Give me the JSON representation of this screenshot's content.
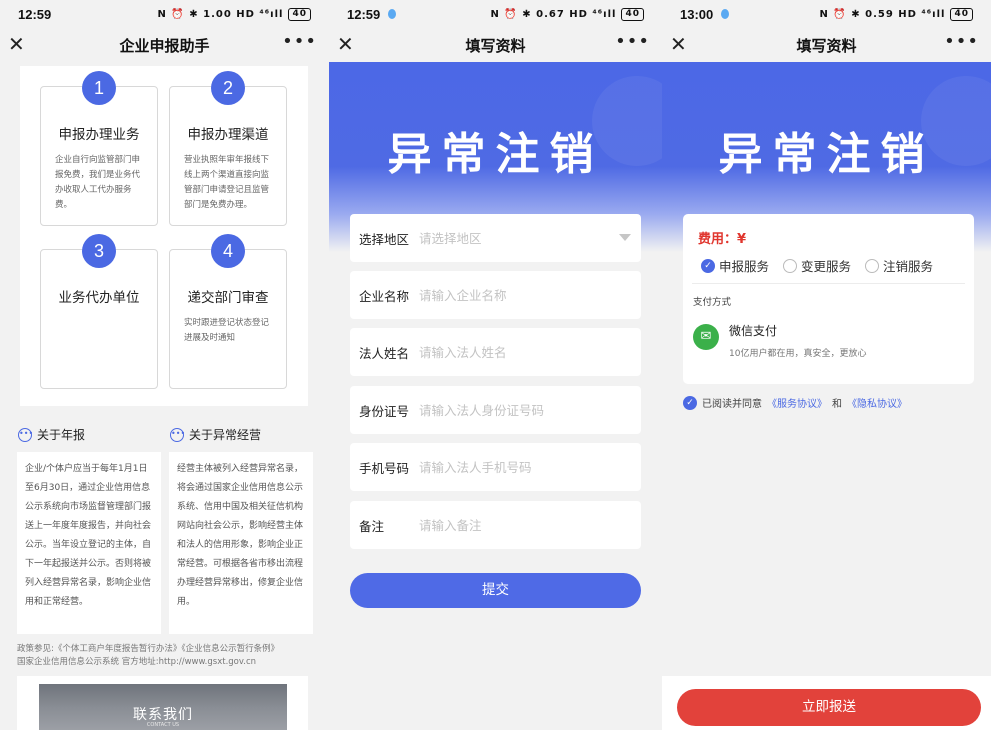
{
  "status_bars": [
    {
      "time": "12:59",
      "icons": "N ⏰ ✱ 1.00 HD ⁴⁶ıll",
      "battery": "40"
    },
    {
      "time": "12:59",
      "icons": "N ⏰ ✱ 0.67 HD ⁴⁶ıll",
      "battery": "40"
    },
    {
      "time": "13:00",
      "icons": "N ⏰ ✱ 0.59 HD ⁴⁶ıll",
      "battery": "40"
    }
  ],
  "nav": {
    "close": "✕",
    "more": "•••",
    "titles": [
      "企业申报助手",
      "填写资料",
      "填写资料"
    ]
  },
  "steps": [
    {
      "num": "1",
      "title": "申报办理业务",
      "desc": "企业自行向监管部门申报免费，我们是业务代办收取人工代办服务费。"
    },
    {
      "num": "2",
      "title": "申报办理渠道",
      "desc": "营业执照年审年报线下线上两个渠道直接向监管部门申请登记且监管部门是免费办理。"
    },
    {
      "num": "3",
      "title": "业务代办单位",
      "desc": ""
    },
    {
      "num": "4",
      "title": "递交部门审查",
      "desc": "实时跟进登记状态登记进展及时通知"
    }
  ],
  "about": [
    {
      "title": "关于年报",
      "text": "企业/个体户应当于每年1月1日至6月30日，通过企业信用信息公示系统向市场监督管理部门报送上一年度年度报告，并向社会公示。当年设立登记的主体，自下一年起报送并公示。否则将被列入经营异常名录，影响企业信用和正常经营。"
    },
    {
      "title": "关于异常经营",
      "text": "经营主体被列入经营异常名录，将会通过国家企业信用信息公示系统、信用中国及相关征信机构网站向社会公示，影响经营主体和法人的信用形象，影响企业正常经营。可根据各省市移出流程办理经营异常移出，修复企业信用。"
    }
  ],
  "policy": {
    "line1": "政策参见:《个体工商户年度报告暂行办法》《企业信息公示暂行条例》",
    "line2": "国家企业信用信息公示系统 官方地址:http://www.gsxt.gov.cn"
  },
  "contact": {
    "title": "联系我们",
    "subtitle": "CONTACT US"
  },
  "hero_title": "异常注销",
  "form": {
    "fields": [
      {
        "label": "选择地区",
        "placeholder": "请选择地区"
      },
      {
        "label": "企业名称",
        "placeholder": "请输入企业名称"
      },
      {
        "label": "法人姓名",
        "placeholder": "请输入法人姓名"
      },
      {
        "label": "身份证号",
        "placeholder": "请输入法人身份证号码"
      },
      {
        "label": "手机号码",
        "placeholder": "请输入法人手机号码"
      },
      {
        "label": "备注",
        "placeholder": "请输入备注"
      }
    ],
    "submit": "提交"
  },
  "payment": {
    "fee_label": "费用：¥",
    "options": [
      {
        "label": "申报服务",
        "selected": true
      },
      {
        "label": "变更服务",
        "selected": false
      },
      {
        "label": "注销服务",
        "selected": false
      }
    ],
    "method_label": "支付方式",
    "method_name": "微信支付",
    "method_desc": "10亿用户都在用，真安全，更放心",
    "agree_text": "已阅读并同意",
    "agree_link1": "《服务协议》",
    "agree_and": "和",
    "agree_link2": "《隐私协议》",
    "report_button": "立即报送"
  },
  "colors": {
    "primary": "#4b69e3",
    "danger": "#e2423b",
    "wechat": "#3bb04a"
  }
}
